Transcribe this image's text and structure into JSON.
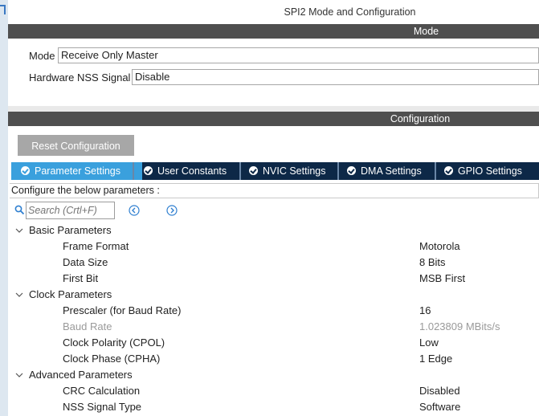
{
  "window_title": "SPI2 Mode and Configuration",
  "mode_section": {
    "header": "Mode",
    "mode_label": "Mode",
    "mode_value": "Receive Only Master",
    "nss_label": "Hardware NSS Signal",
    "nss_value": "Disable"
  },
  "config_section": {
    "header": "Configuration",
    "reset_button": "Reset Configuration",
    "tabs": [
      {
        "label": "Parameter Settings",
        "active": true
      },
      {
        "label": "User Constants",
        "active": false
      },
      {
        "label": "NVIC Settings",
        "active": false
      },
      {
        "label": "DMA Settings",
        "active": false
      },
      {
        "label": "GPIO Settings",
        "active": false
      }
    ],
    "info_text": "Configure the below parameters :",
    "search_placeholder": "Search (Crtl+F)"
  },
  "groups": [
    {
      "label": "Basic Parameters",
      "params": [
        {
          "name": "Frame Format",
          "value": "Motorola",
          "dimmed": false
        },
        {
          "name": "Data Size",
          "value": "8 Bits",
          "dimmed": false
        },
        {
          "name": "First Bit",
          "value": "MSB First",
          "dimmed": false
        }
      ]
    },
    {
      "label": "Clock Parameters",
      "params": [
        {
          "name": "Prescaler (for Baud Rate)",
          "value": "16",
          "dimmed": false
        },
        {
          "name": "Baud Rate",
          "value": "1.023809 MBits/s",
          "dimmed": true
        },
        {
          "name": "Clock Polarity (CPOL)",
          "value": "Low",
          "dimmed": false
        },
        {
          "name": "Clock Phase (CPHA)",
          "value": "1 Edge",
          "dimmed": false
        }
      ]
    },
    {
      "label": "Advanced Parameters",
      "params": [
        {
          "name": "CRC Calculation",
          "value": "Disabled",
          "dimmed": false
        },
        {
          "name": "NSS Signal Type",
          "value": "Software",
          "dimmed": false
        }
      ]
    }
  ],
  "colors": {
    "header_bar": "#4f4f4f",
    "tab_bar": "#0d2847",
    "tab_active": "#3aa0dd",
    "reset_button": "#a7a7a7",
    "dimmed_text": "#9a9a9a"
  }
}
